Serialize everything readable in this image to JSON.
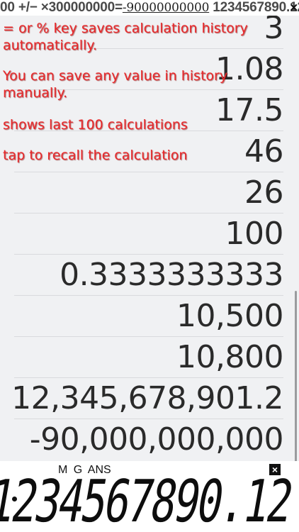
{
  "history_strip": {
    "prefix": "00 +/−",
    "multiply": "×300000000=",
    "negative_result": "-90000000000",
    "current": "1234567890.12",
    "close_glyph": "×"
  },
  "help_texts": [
    "= or % key saves calculation history automatically.",
    "You can save any value in history manually.",
    "shows last 100 calculations",
    "tap to recall the calculation"
  ],
  "history": [
    "3",
    "1.08",
    "17.5",
    "46",
    "26",
    "100",
    "0.3333333333",
    "10,500",
    "10,800",
    "12,345,678,901.2",
    "-90,000,000,000"
  ],
  "display": {
    "indicators": "M  G  ANS",
    "close_glyph": "×",
    "value": "1234567890.12"
  }
}
